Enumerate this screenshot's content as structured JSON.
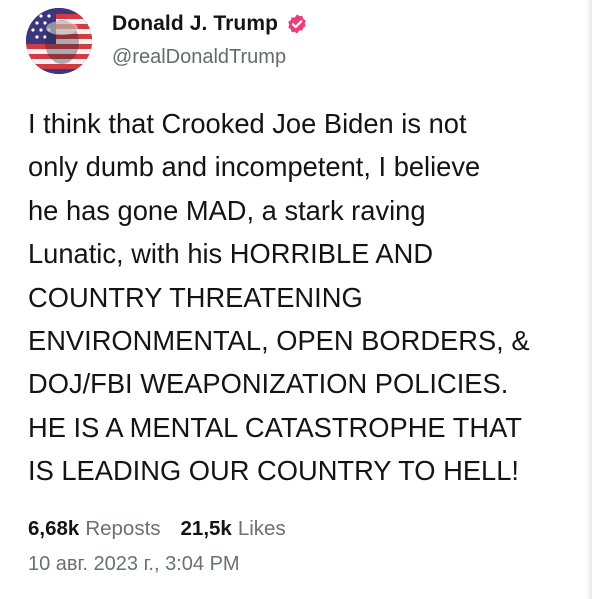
{
  "author": {
    "display_name": "Donald J. Trump",
    "handle": "@realDonaldTrump",
    "verified": true,
    "verified_color": "#e8407f"
  },
  "post": {
    "lines": [
      "I think that Crooked Joe Biden is not",
      "only dumb and incompetent, I believe",
      "he has gone MAD, a stark raving",
      "Lunatic, with his HORRIBLE AND",
      "COUNTRY THREATENING",
      "ENVIRONMENTAL, OPEN BORDERS, &",
      "DOJ/FBI WEAPONIZATION POLICIES.",
      "HE IS A MENTAL CATASTROPHE THAT",
      "IS LEADING OUR COUNTRY TO HELL!"
    ]
  },
  "stats": {
    "reposts_count": "6,68k",
    "reposts_label": "Reposts",
    "likes_count": "21,5k",
    "likes_label": "Likes"
  },
  "timestamp": "10 авг. 2023 г., 3:04 PM"
}
